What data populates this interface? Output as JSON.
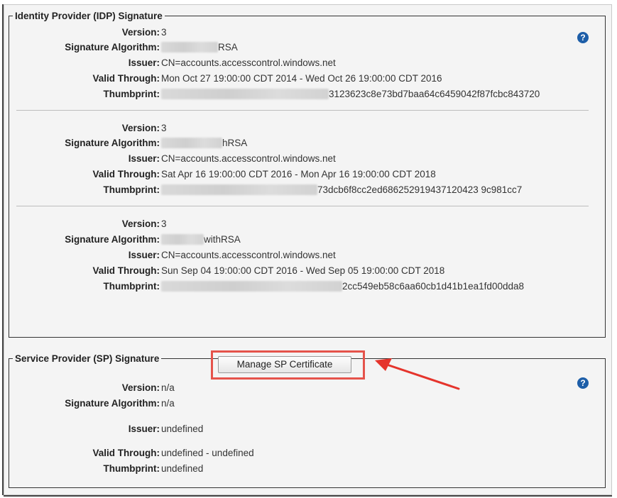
{
  "idp": {
    "legend": "Identity Provider (IDP) Signature",
    "labels": {
      "version": "Version:",
      "algorithm": "Signature Algorithm:",
      "issuer": "Issuer:",
      "valid": "Valid Through:",
      "thumbprint": "Thumbprint:"
    },
    "certs": [
      {
        "version": "3",
        "algorithm_suffix": "RSA",
        "issuer": "CN=accounts.accesscontrol.windows.net",
        "valid": "Mon Oct 27 19:00:00 CDT 2014 - Wed Oct 26 19:00:00 CDT 2016",
        "thumbprint_suffix": "3123623c8e73bd7baa64c6459042f87fcbc843720"
      },
      {
        "version": "3",
        "algorithm_suffix": "hRSA",
        "issuer": "CN=accounts.accesscontrol.windows.net",
        "valid": "Sat Apr 16 19:00:00 CDT 2016 - Mon Apr 16 19:00:00 CDT 2018",
        "thumbprint_suffix": "73dcb6f8cc2ed686252919437120423 9c981cc7"
      },
      {
        "version": "3",
        "algorithm_suffix": "withRSA",
        "issuer": "CN=accounts.accesscontrol.windows.net",
        "valid": "Sun Sep 04 19:00:00 CDT 2016 - Wed Sep 05 19:00:00 CDT 2018",
        "thumbprint_suffix": "2cc549eb58c6aa60cb1d41b1ea1fd00dda8"
      }
    ]
  },
  "sp": {
    "legend": "Service Provider (SP) Signature",
    "manage_button": "Manage SP Certificate",
    "labels": {
      "version": "Version:",
      "algorithm": "Signature Algorithm:",
      "issuer": "Issuer:",
      "valid": "Valid Through:",
      "thumbprint": "Thumbprint:"
    },
    "version": "n/a",
    "algorithm": "n/a",
    "issuer": "undefined",
    "valid": "undefined - undefined",
    "thumbprint": "undefined"
  },
  "help_icon": "?",
  "colors": {
    "help": "#1d5ea8",
    "highlight": "#e5534b",
    "arrow": "#e5342c"
  }
}
